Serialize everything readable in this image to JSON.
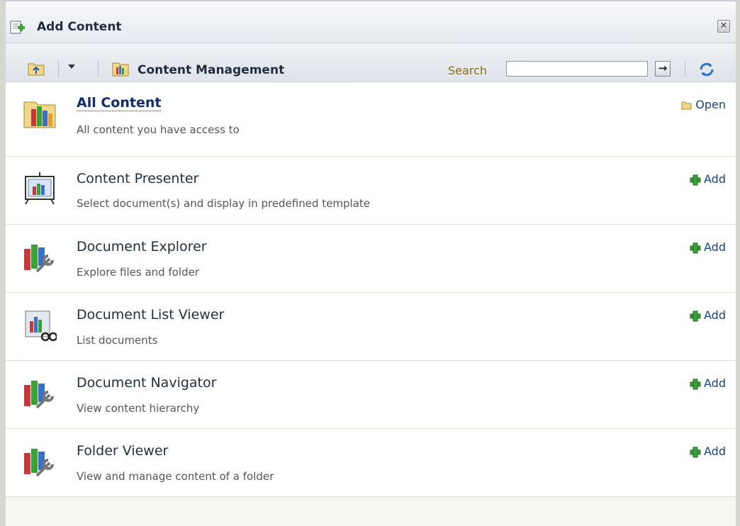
{
  "dialog": {
    "title": "Add Content",
    "close_label": "✕"
  },
  "toolbar": {
    "breadcrumb_label": "Content Management",
    "search_label": "Search",
    "search_value": "",
    "go_label": "→"
  },
  "items": [
    {
      "title": "All Content",
      "desc": "All content you have access to",
      "action": "Open",
      "icon": "library-folder-icon",
      "action_icon": "open-folder-icon"
    },
    {
      "title": "Content Presenter",
      "desc": "Select document(s) and display in predefined template",
      "action": "Add",
      "icon": "presentation-board-icon",
      "action_icon": "add-icon"
    },
    {
      "title": "Document Explorer",
      "desc": "Explore files and folder",
      "action": "Add",
      "icon": "books-wrench-icon",
      "action_icon": "add-icon"
    },
    {
      "title": "Document List Viewer",
      "desc": "List documents",
      "action": "Add",
      "icon": "chart-glasses-icon",
      "action_icon": "add-icon"
    },
    {
      "title": "Document Navigator",
      "desc": "View content hierarchy",
      "action": "Add",
      "icon": "books-wrench-icon",
      "action_icon": "add-icon"
    },
    {
      "title": "Folder Viewer",
      "desc": "View and manage content of a folder",
      "action": "Add",
      "icon": "books-wrench-icon",
      "action_icon": "add-icon"
    }
  ],
  "colors": {
    "link": "#0f2c6d",
    "action": "#1a3f8a",
    "search_label": "#8a6d1a"
  }
}
